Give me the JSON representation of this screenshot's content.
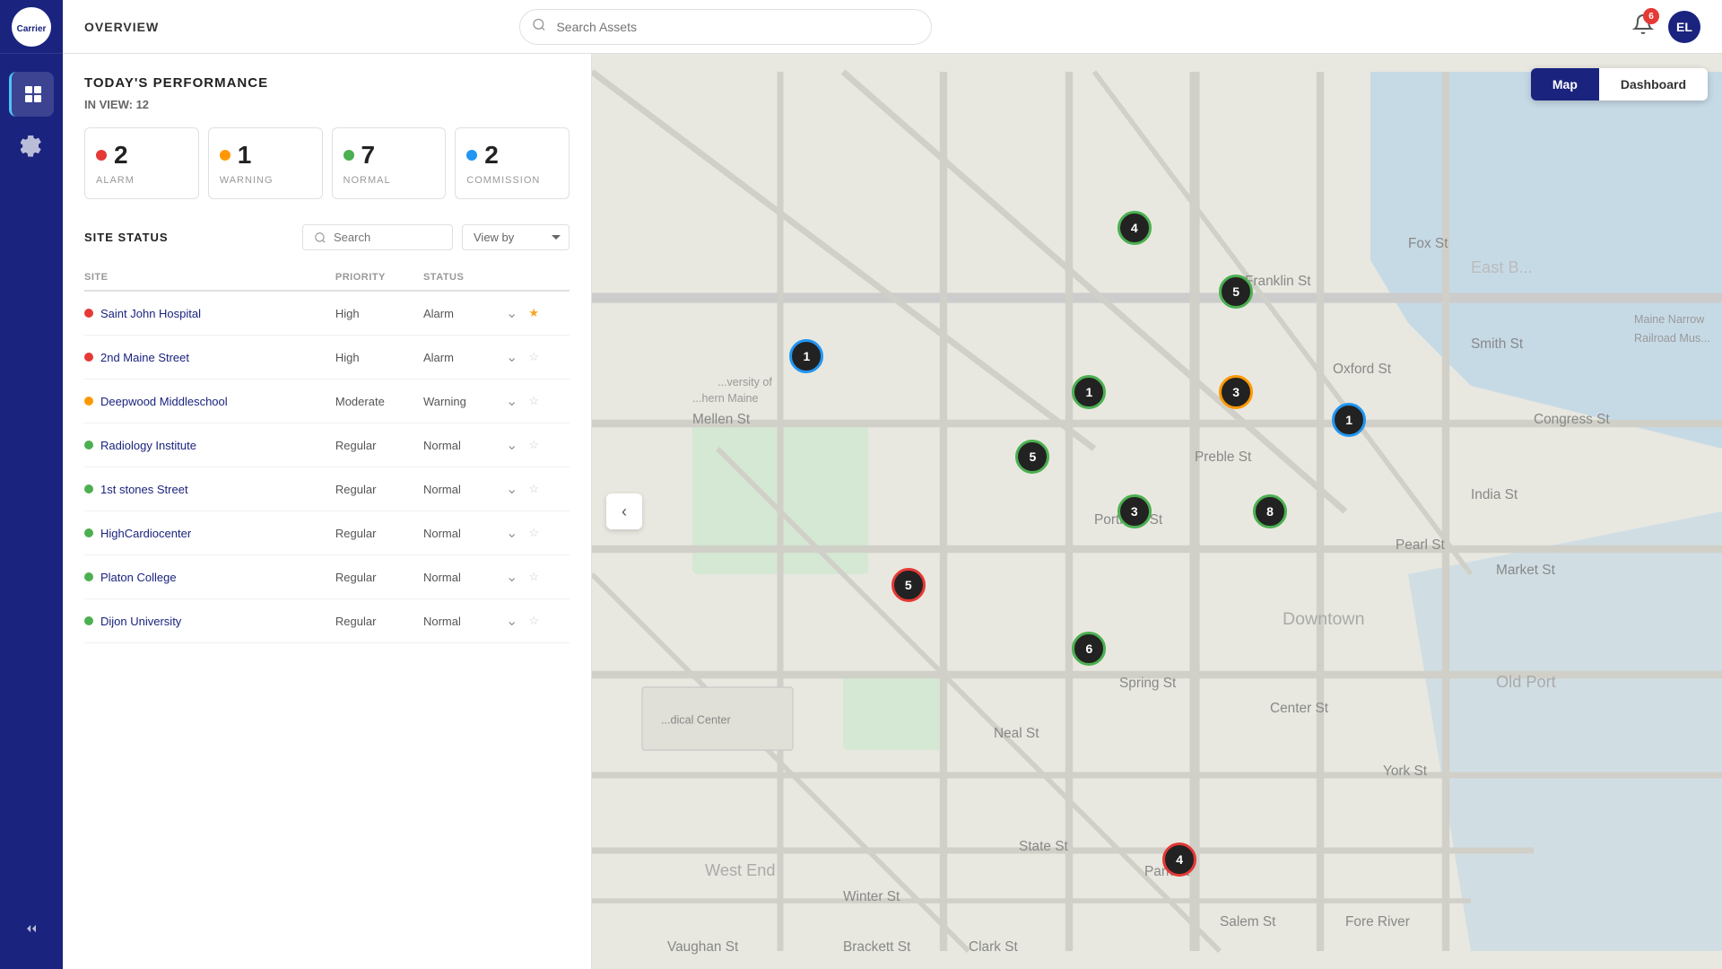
{
  "app": {
    "logo_text": "Carrier",
    "header_title": "OVERVIEW",
    "search_placeholder": "Search Assets",
    "notification_count": "6",
    "user_initials": "EL"
  },
  "sidebar": {
    "items": [
      {
        "id": "dashboard",
        "icon": "grid",
        "active": true
      },
      {
        "id": "settings",
        "icon": "gear",
        "active": false
      }
    ],
    "collapse_label": "Collapse"
  },
  "performance": {
    "section_title": "TODAY'S PERFORMANCE",
    "in_view_label": "IN VIEW:",
    "in_view_count": "12",
    "stats": [
      {
        "id": "alarm",
        "count": "2",
        "label": "ALARM",
        "color": "#e53935"
      },
      {
        "id": "warning",
        "count": "1",
        "label": "WARNING",
        "color": "#ff9800"
      },
      {
        "id": "normal",
        "count": "7",
        "label": "NORMAL",
        "color": "#4caf50"
      },
      {
        "id": "commission",
        "count": "2",
        "label": "COMMISSION",
        "color": "#2196f3"
      }
    ]
  },
  "site_status": {
    "title": "SITE STATUS",
    "search_placeholder": "Search",
    "view_by_label": "View by",
    "columns": [
      {
        "id": "site",
        "label": "SITE"
      },
      {
        "id": "priority",
        "label": "PRIORITY"
      },
      {
        "id": "status",
        "label": "STATUS"
      }
    ],
    "sites": [
      {
        "id": 1,
        "name": "Saint John Hospital",
        "priority": "High",
        "status": "Alarm",
        "color": "#e53935",
        "starred": true
      },
      {
        "id": 2,
        "name": "2nd Maine Street",
        "priority": "High",
        "status": "Alarm",
        "color": "#e53935",
        "starred": false
      },
      {
        "id": 3,
        "name": "Deepwood Middleschool",
        "priority": "Moderate",
        "status": "Warning",
        "color": "#ff9800",
        "starred": false
      },
      {
        "id": 4,
        "name": "Radiology Institute",
        "priority": "Regular",
        "status": "Normal",
        "color": "#4caf50",
        "starred": false
      },
      {
        "id": 5,
        "name": "1st stones Street",
        "priority": "Regular",
        "status": "Normal",
        "color": "#4caf50",
        "starred": false
      },
      {
        "id": 6,
        "name": "HighCardiocenter",
        "priority": "Regular",
        "status": "Normal",
        "color": "#4caf50",
        "starred": false
      },
      {
        "id": 7,
        "name": "Platon College",
        "priority": "Regular",
        "status": "Normal",
        "color": "#4caf50",
        "starred": false
      },
      {
        "id": 8,
        "name": "Dijon University",
        "priority": "Regular",
        "status": "Normal",
        "color": "#4caf50",
        "starred": false
      }
    ]
  },
  "map": {
    "toggle_map_label": "Map",
    "toggle_dashboard_label": "Dashboard",
    "back_label": "‹",
    "markers": [
      {
        "id": "m1",
        "label": "4",
        "top": "19",
        "left": "48",
        "border_color": "#4caf50"
      },
      {
        "id": "m2",
        "label": "5",
        "top": "26",
        "left": "57",
        "border_color": "#4caf50"
      },
      {
        "id": "m3",
        "label": "1",
        "top": "33",
        "left": "19",
        "border_color": "#2196f3"
      },
      {
        "id": "m4",
        "label": "1",
        "top": "37",
        "left": "44",
        "border_color": "#4caf50"
      },
      {
        "id": "m5",
        "label": "3",
        "top": "37",
        "left": "57",
        "border_color": "#ff9800"
      },
      {
        "id": "m6",
        "label": "1",
        "top": "40",
        "left": "67",
        "border_color": "#2196f3"
      },
      {
        "id": "m7",
        "label": "5",
        "top": "44",
        "left": "39",
        "border_color": "#4caf50"
      },
      {
        "id": "m8",
        "label": "3",
        "top": "50",
        "left": "48",
        "border_color": "#4caf50"
      },
      {
        "id": "m9",
        "label": "8",
        "top": "50",
        "left": "60",
        "border_color": "#4caf50"
      },
      {
        "id": "m10",
        "label": "5",
        "top": "58",
        "left": "28",
        "border_color": "#e53935"
      },
      {
        "id": "m11",
        "label": "6",
        "top": "65",
        "left": "44",
        "border_color": "#4caf50"
      },
      {
        "id": "m12",
        "label": "4",
        "top": "88",
        "left": "52",
        "border_color": "#e53935"
      }
    ]
  }
}
